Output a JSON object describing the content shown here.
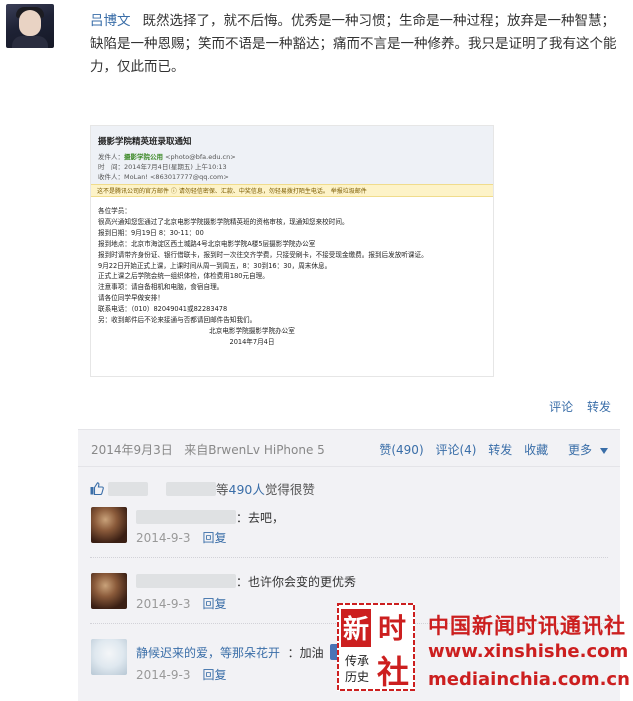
{
  "post": {
    "author": "吕博文",
    "text": "既然选择了，就不后悔。优秀是一种习惯；生命是一种过程；放弃是一种智慧；缺陷是一种恩赐；笑而不语是一种豁达；痛而不言是一种修养。我只是证明了我有这个能力，仅此而已。",
    "email": {
      "title": "摄影学院精英班录取通知",
      "sender_label": "发件人：",
      "sender_name": "摄影学院公用",
      "sender_addr": "<photo@bfa.edu.cn>",
      "time_label": "时　间：",
      "time_value": "2014年7月4日(星期五) 上午10:13",
      "recipient_label": "收件人：",
      "recipient_value": "MoLan! <863017777@qq.com>",
      "warning": "这不是腾讯公司的官方邮件 ⓘ    请勿轻信密保、汇款、中奖信息，勿轻易拨打陌生电话。    举报垃圾邮件",
      "body_lines": [
        "各位学员：",
        "很高兴通知您您通过了北京电影学院摄影学院精英班的资格审核，现通知您来校时间。",
        "报到日期：9月19日 8：30-11：00",
        "报到地点：北京市海淀区西土城路4号北京电影学院A楼5层摄影学院办公室",
        "报到时请带齐身份证、银行借联卡，报到时一次往交齐学费，只接受刷卡，不接受现金缴费。报到后发放听课证。",
        "9月22日开始正式上课，上课时间从周一到周五，8：30到16：30，周末休息。",
        "正式上课之后学院会统一组织体检，体检费用180元自理。",
        "注意事项：请自备相机和电脑，食宿自理。",
        "请各位同学早做安排！",
        "联系电话：（010）82049041或82283478",
        "另：收到邮件后不论来接通与否都请回邮件告知我们。"
      ],
      "signature": "北京电影学院摄影学院办公室",
      "sign_date": "2014年7月4日"
    },
    "actions": {
      "comment": "评论",
      "repost": "转发"
    }
  },
  "meta": {
    "date": "2014年9月3日",
    "source": "来自BrwenLv HiPhone 5",
    "like": "赞(490)",
    "comment": "评论(4)",
    "repost": "转发",
    "favorite": "收藏",
    "more": "更多"
  },
  "likes": {
    "prefix": "等",
    "count": "490人",
    "suffix": "觉得很赞"
  },
  "comments": [
    {
      "name": "",
      "text": "：去吧，",
      "date": "2014-9-3",
      "reply": "回复"
    },
    {
      "name": "",
      "text": "：也许你会变的更优秀",
      "date": "2014-9-3",
      "reply": "回复"
    },
    {
      "name": "静候迟来的爱，等那朵花开",
      "text": "：加油",
      "date": "2014-9-3",
      "reply": "回复"
    }
  ],
  "watermark": {
    "seal_top": "新 时",
    "seal_bottom": "传承 历史",
    "seal_big": "社",
    "line1": "中国新闻时讯通讯社",
    "line2": "www.xinshishe.com",
    "line3": "mediainchia.com.cn"
  },
  "colors": {
    "link": "#3a6ea8",
    "meta_bg": "#f2f2f5",
    "watermark": "#cc1f1f"
  }
}
